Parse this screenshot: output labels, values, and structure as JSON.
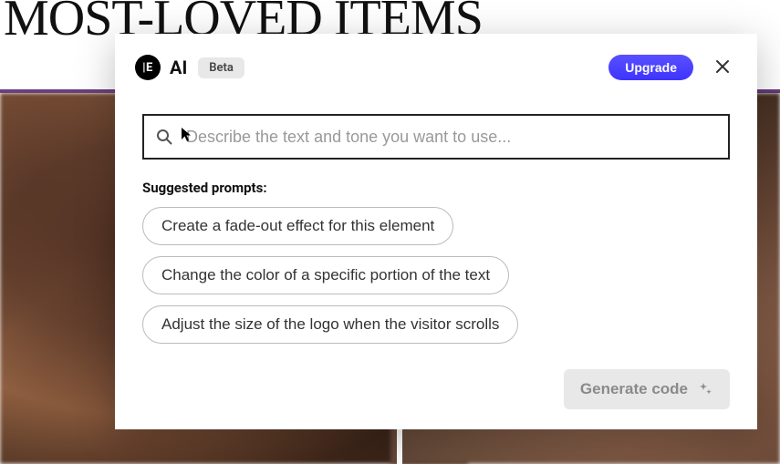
{
  "background": {
    "heading": "MOST-LOVED ITEMS"
  },
  "modal": {
    "logo_text": "|E",
    "title": "AI",
    "beta_label": "Beta",
    "upgrade_label": "Upgrade",
    "search_placeholder": "Describe the text and tone you want to use...",
    "suggested_label": "Suggested prompts:",
    "prompts": [
      "Create a fade-out effect for this element",
      "Change the color of a specific portion of the text",
      "Adjust the size of the logo when the visitor scrolls"
    ],
    "generate_label": "Generate code"
  }
}
